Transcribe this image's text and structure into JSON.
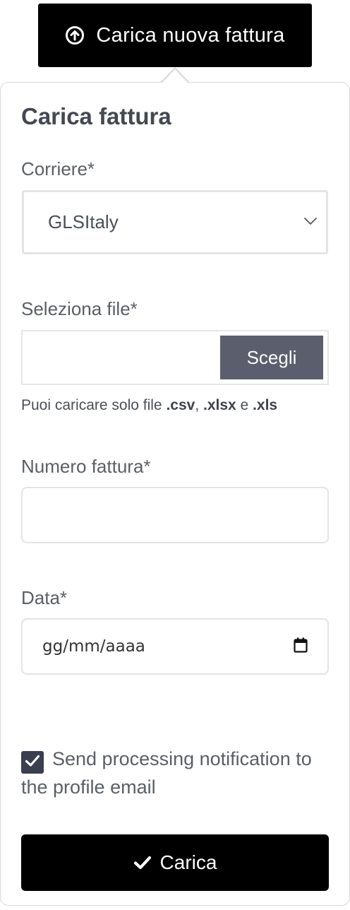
{
  "header": {
    "upload_button_label": "Carica nuova fattura",
    "upload_icon": "circle-arrow-up-icon"
  },
  "form": {
    "title": "Carica fattura",
    "courier": {
      "label": "Corriere*",
      "selected": "GLSItaly"
    },
    "file": {
      "label": "Seleziona file*",
      "button_label": "Scegli",
      "hint_prefix": "Puoi caricare solo file ",
      "hint_ext1": ".csv",
      "hint_sep1": ", ",
      "hint_ext2": ".xlsx",
      "hint_sep2": " e ",
      "hint_ext3": ".xls"
    },
    "invoice_number": {
      "label": "Numero fattura*",
      "value": ""
    },
    "date": {
      "label": "Data*",
      "placeholder": "gg/mm/aaaa"
    },
    "notification": {
      "checked": true,
      "label": "Send processing notification to the profile email"
    },
    "submit_label": "Carica"
  },
  "colors": {
    "primary": "#000000",
    "file_button": "#5b5e6c",
    "checkbox": "#3a3f4f",
    "border": "#d7d9dc"
  }
}
